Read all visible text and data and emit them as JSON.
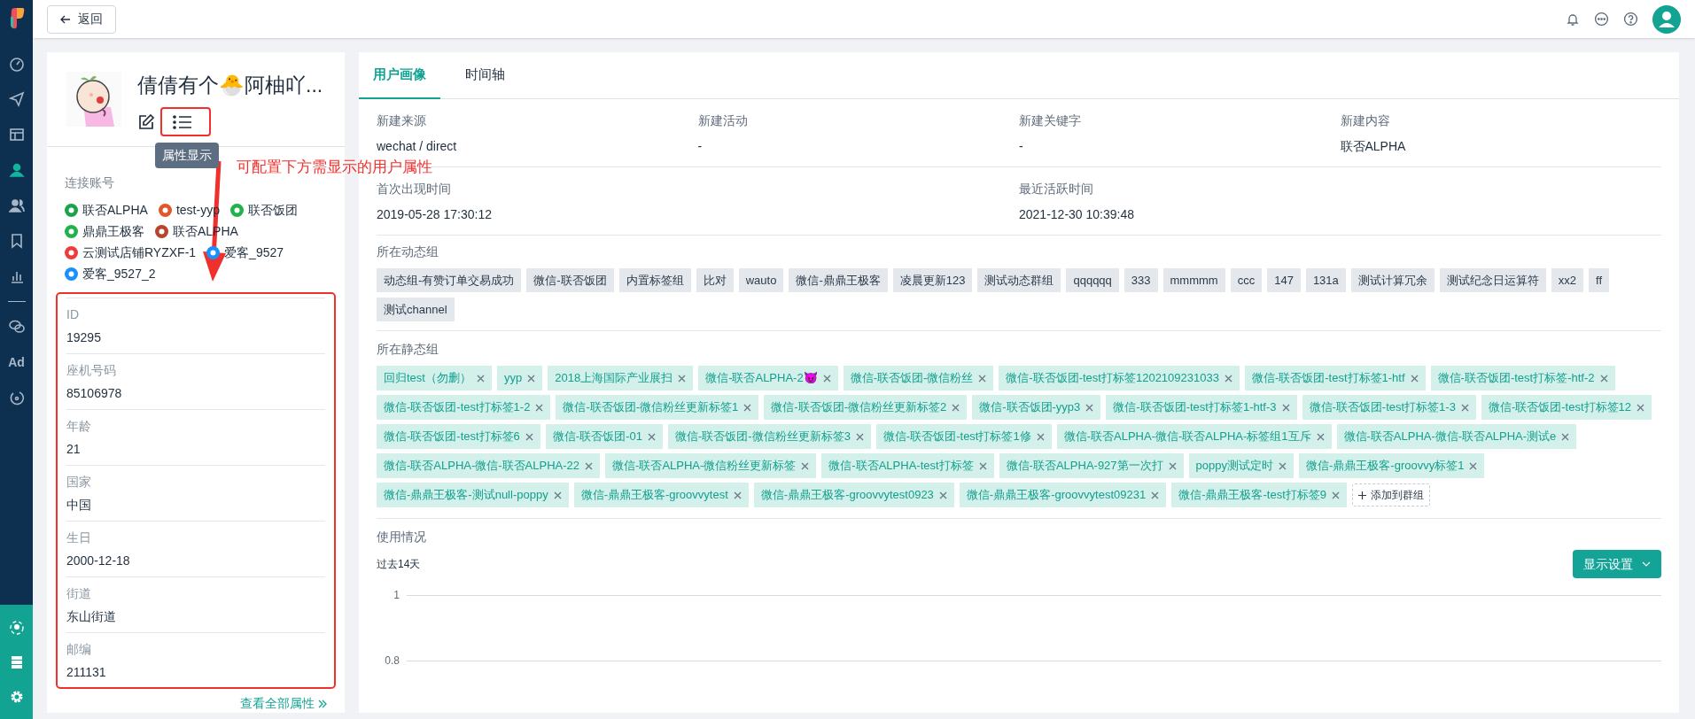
{
  "nav_items": [
    {
      "kind": "dashboard",
      "selected": false
    },
    {
      "kind": "send",
      "selected": false
    },
    {
      "kind": "layout",
      "selected": false
    },
    {
      "kind": "user",
      "selected": true
    },
    {
      "kind": "users",
      "selected": false
    },
    {
      "kind": "bookmark",
      "selected": false
    },
    {
      "kind": "chart",
      "selected": false
    },
    {
      "kind": "divider",
      "selected": false
    },
    {
      "kind": "chat",
      "selected": false
    },
    {
      "kind": "text",
      "label": "Ad",
      "selected": false
    },
    {
      "kind": "circle",
      "selected": false
    }
  ],
  "bottom_nav": [
    {
      "kind": "network"
    },
    {
      "kind": "server"
    },
    {
      "kind": "gear"
    }
  ],
  "back_button": "返回",
  "profile": {
    "name": "倩倩有个🐣阿柚吖...",
    "tooltip": "属性显示"
  },
  "accounts_title": "连接账号",
  "accounts": [
    {
      "name": "联否ALPHA",
      "color": "#1aa34a"
    },
    {
      "name": "test-yyp",
      "color": "#e0582a"
    },
    {
      "name": "联否饭团",
      "color": "#22b14c"
    },
    {
      "name": "鼎鼎王极客",
      "color": "#22b14c"
    },
    {
      "name": "联否ALPHA",
      "color": "#b5452b"
    },
    {
      "name": "云测试店铺RYZXF-1",
      "color": "#ee3b3b"
    },
    {
      "name": "爱客_9527",
      "color": "#1890ff"
    },
    {
      "name": "爱客_9527_2",
      "color": "#1890ff"
    }
  ],
  "attributes": [
    {
      "label": "ID",
      "value": "19295"
    },
    {
      "label": "座机号码",
      "value": "85106978"
    },
    {
      "label": "年龄",
      "value": "21"
    },
    {
      "label": "国家",
      "value": "中国"
    },
    {
      "label": "生日",
      "value": "2000-12-18"
    },
    {
      "label": "街道",
      "value": "东山街道"
    },
    {
      "label": "邮编",
      "value": "211131"
    }
  ],
  "view_all_link": "查看全部属性",
  "annotation": {
    "note": "可配置下方需显示的用户属性"
  },
  "tabs": [
    {
      "label": "用户画像",
      "selected": true
    },
    {
      "label": "时间轴",
      "selected": false
    }
  ],
  "info_rows": [
    [
      {
        "label": "新建来源",
        "value": "wechat / direct"
      },
      {
        "label": "新建活动",
        "value": "-"
      },
      {
        "label": "新建关键字",
        "value": "-"
      },
      {
        "label": "新建内容",
        "value": "联否ALPHA"
      }
    ],
    [
      {
        "label": "首次出现时间",
        "value": "2019-05-28 17:30:12"
      },
      {
        "label": "最近活跃时间",
        "value": "2021-12-30 10:39:48"
      }
    ]
  ],
  "dynamic_groups": {
    "title": "所在动态组",
    "tags": [
      "动态组-有赞订单交易成功",
      "微信-联否饭团",
      "内置标签组",
      "比对",
      "wauto",
      "微信-鼎鼎王极客",
      "凌晨更新123",
      "测试动态群组",
      "qqqqqq",
      "333",
      "mmmmm",
      "ccc",
      "147",
      "131a",
      "测试计算冗余",
      "测试纪念日运算符",
      "xx2",
      "ff",
      "测试channel"
    ]
  },
  "static_groups": {
    "title": "所在静态组",
    "tags": [
      "回归test（勿删）",
      "yyp",
      "2018上海国际产业展扫",
      "微信-联否ALPHA-2😈",
      "微信-联否饭团-微信粉丝",
      "微信-联否饭团-test打标签1202109231033",
      "微信-联否饭团-test打标签1-htf",
      "微信-联否饭团-test打标签-htf-2",
      "微信-联否饭团-test打标签1-2",
      "微信-联否饭团-微信粉丝更新标签1",
      "微信-联否饭团-微信粉丝更新标签2",
      "微信-联否饭团-yyp3",
      "微信-联否饭团-test打标签1-htf-3",
      "微信-联否饭团-test打标签1-3",
      "微信-联否饭团-test打标签12",
      "微信-联否饭团-test打标签6",
      "微信-联否饭团-01",
      "微信-联否饭团-微信粉丝更新标签3",
      "微信-联否饭团-test打标签1修",
      "微信-联否ALPHA-微信-联否ALPHA-标签组1互斥",
      "微信-联否ALPHA-微信-联否ALPHA-测试e",
      "微信-联否ALPHA-微信-联否ALPHA-22",
      "微信-联否ALPHA-微信粉丝更新标签",
      "微信-联否ALPHA-test打标签",
      "微信-联否ALPHA-927第一次打",
      "poppy测试定时",
      "微信-鼎鼎王极客-groovvy标签1",
      "微信-鼎鼎王极客-测试null-poppy",
      "微信-鼎鼎王极客-groovvytest",
      "微信-鼎鼎王极客-groovvytest0923",
      "微信-鼎鼎王极客-groovvytest09231",
      "微信-鼎鼎王极客-test打标签9"
    ],
    "add_button": "添加到群组"
  },
  "usage": {
    "title": "使用情况",
    "period": "过去14天",
    "settings_button": "显示设置",
    "gridlines": [
      "1",
      "0.8"
    ]
  }
}
